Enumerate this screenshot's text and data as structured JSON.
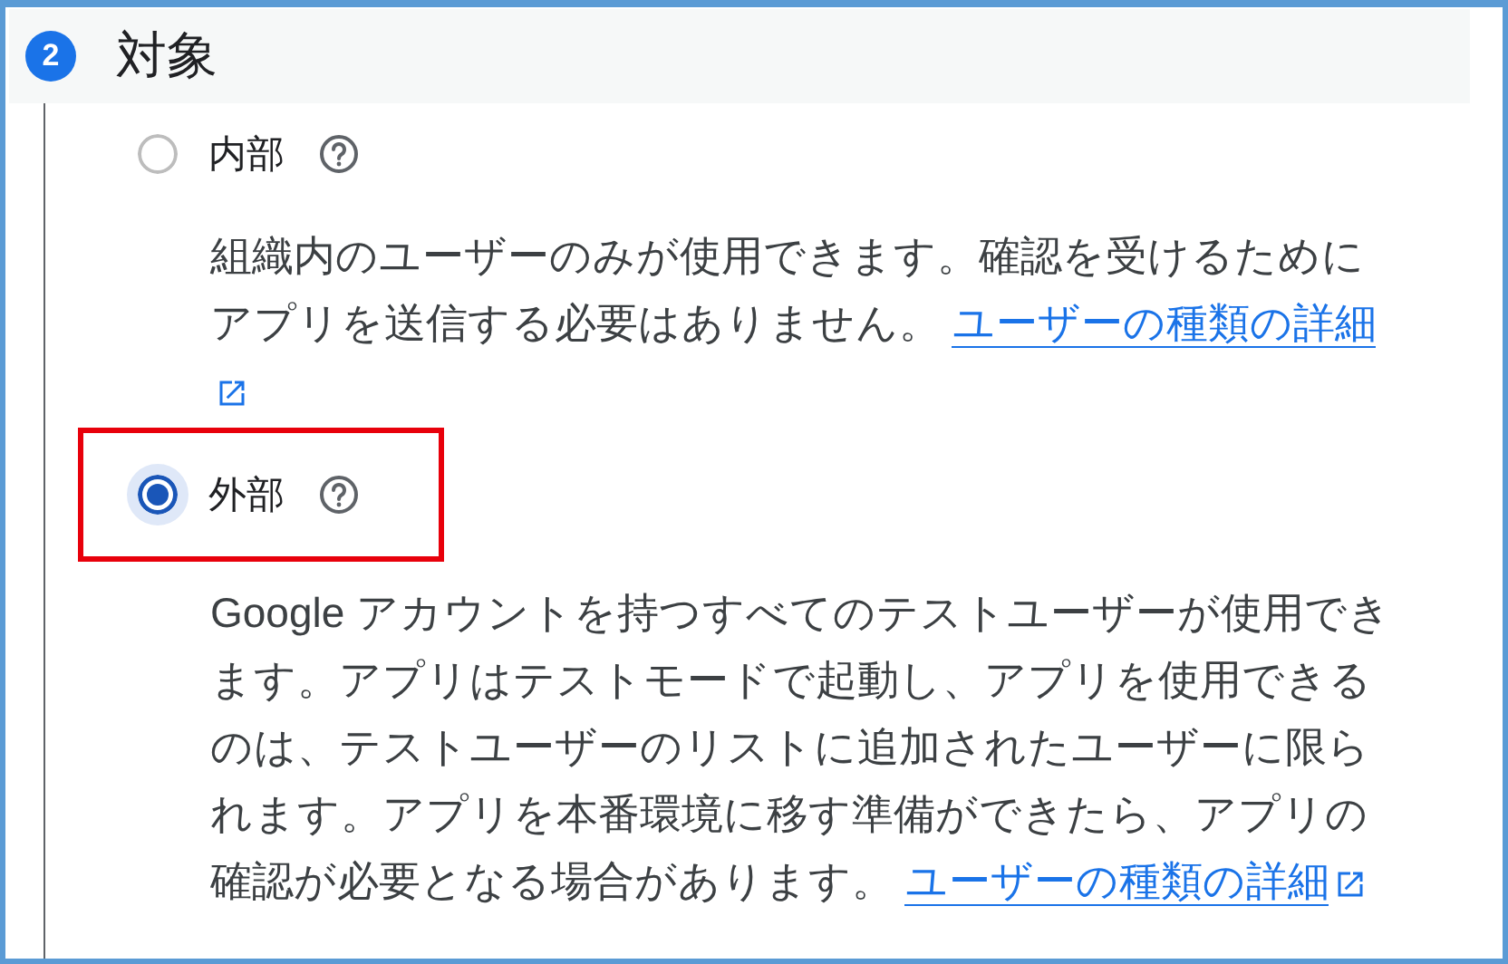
{
  "section": {
    "number": "2",
    "title": "対象"
  },
  "options": [
    {
      "label": "内部",
      "selected": false,
      "highlighted": false,
      "description": "組織内のユーザーのみが使用できます。確認を受けるためにアプリを送信する必要はありません。",
      "link": "ユーザーの種類の詳細"
    },
    {
      "label": "外部",
      "selected": true,
      "highlighted": true,
      "description": "Google アカウントを持つすべてのテストユーザーが使用できます。アプリはテストモードで起動し、アプリを使用できるのは、テストユーザーのリストに追加されたユーザーに限られます。アプリを本番環境に移す準備ができたら、アプリの確認が必要となる場合があります。",
      "link": "ユーザーの種類の詳細"
    }
  ]
}
